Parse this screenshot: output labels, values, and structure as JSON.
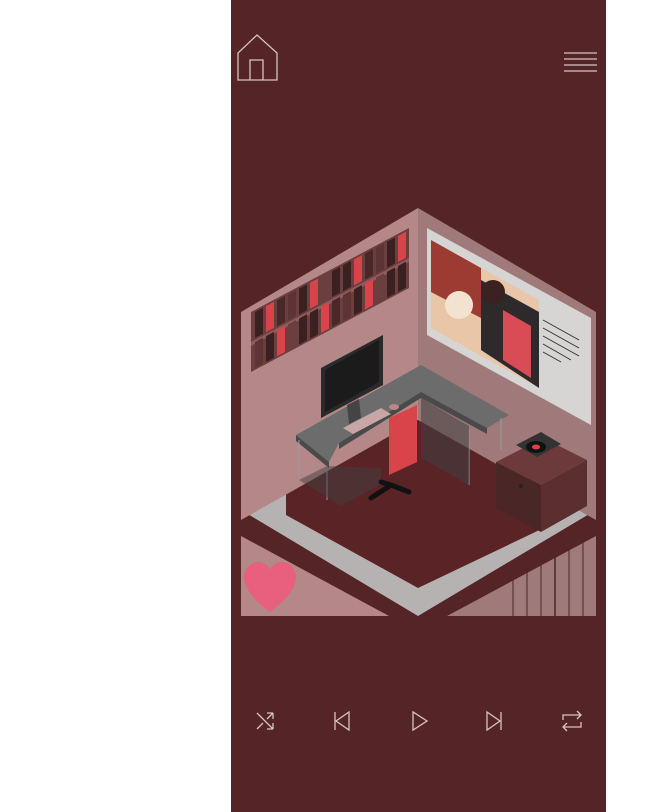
{
  "app": {
    "background": "#552426",
    "page_background": "#ffffff"
  },
  "header": {
    "home_icon": "home-icon",
    "menu_icon": "hamburger-menu-icon"
  },
  "scene": {
    "description_icons": [
      "bookshelf-icon",
      "painting-icon",
      "monitor-icon",
      "desk-icon",
      "record-player-icon",
      "office-chair-icon",
      "heart-icon",
      "radiator-icon"
    ],
    "colors": {
      "floor": "#5a2326",
      "wall": "#b58a8a",
      "border": "#c6c1c1",
      "accent_red": "#d9444b",
      "heart": "#e8607d"
    }
  },
  "player": {
    "controls": [
      {
        "name": "shuffle",
        "icon": "shuffle-icon"
      },
      {
        "name": "previous",
        "icon": "skip-previous-icon"
      },
      {
        "name": "play",
        "icon": "play-icon"
      },
      {
        "name": "next",
        "icon": "skip-next-icon"
      },
      {
        "name": "repeat",
        "icon": "repeat-icon"
      }
    ]
  }
}
